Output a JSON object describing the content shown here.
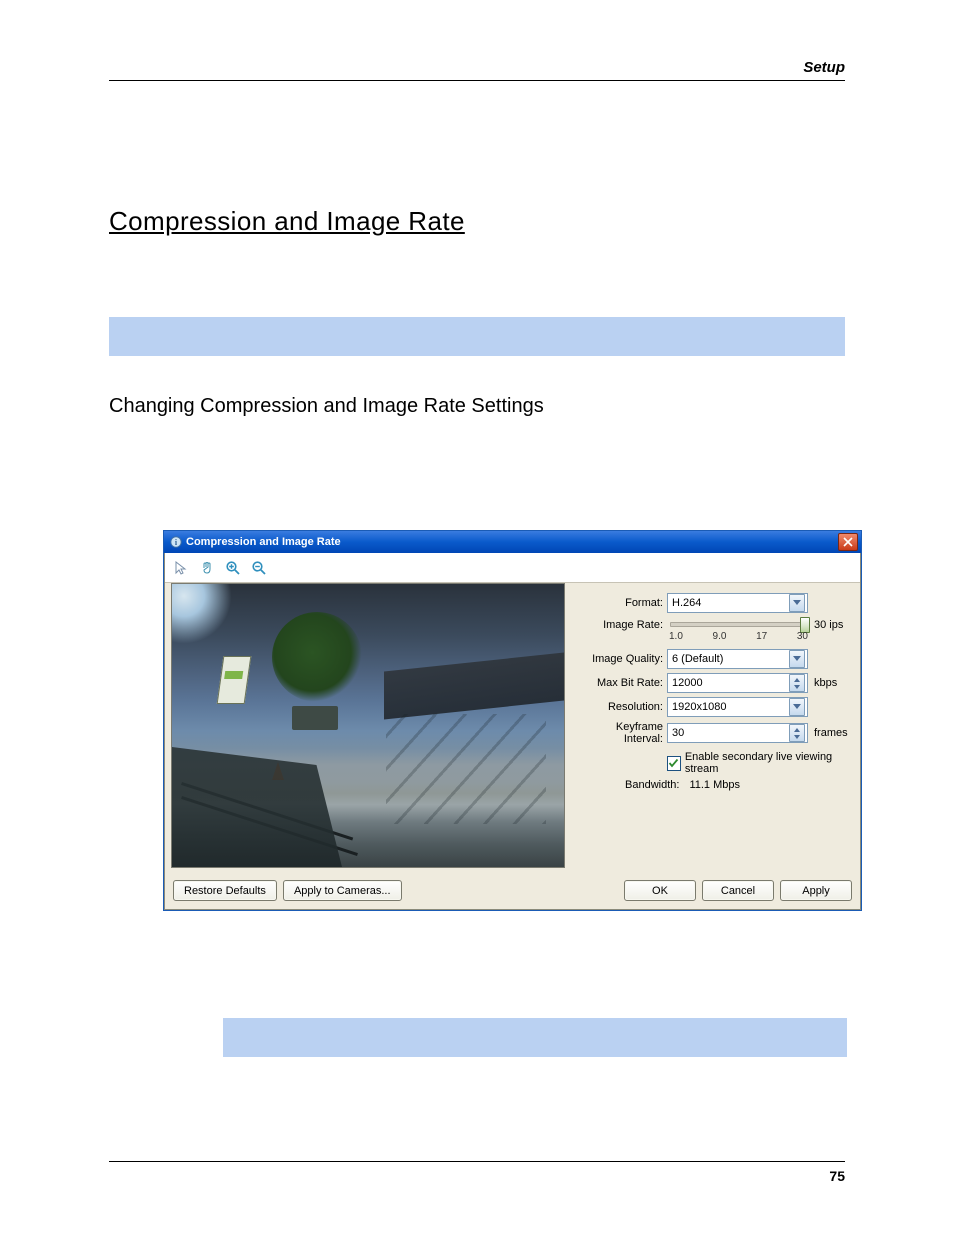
{
  "page": {
    "header": "Setup",
    "number": "75",
    "section_title": "Compression and Image Rate",
    "subheading": "Changing Compression and Image Rate Settings"
  },
  "dialog": {
    "title": "Compression and Image Rate",
    "fields": {
      "format": {
        "label": "Format:",
        "value": "H.264"
      },
      "image_rate": {
        "label": "Image Rate:",
        "ticks": [
          "1.0",
          "9.0",
          "17",
          "30"
        ],
        "value_label": "30 ips",
        "value": 30,
        "min": 1.0,
        "max": 30
      },
      "image_quality": {
        "label": "Image Quality:",
        "value": "6 (Default)"
      },
      "max_bit_rate": {
        "label": "Max Bit Rate:",
        "value": "12000",
        "unit": "kbps"
      },
      "resolution": {
        "label": "Resolution:",
        "value": "1920x1080"
      },
      "keyframe_interval": {
        "label": "Keyframe Interval:",
        "value": "30",
        "unit": "frames"
      },
      "enable_secondary": {
        "label": "Enable secondary live viewing stream",
        "checked": true
      },
      "bandwidth": {
        "label": "Bandwidth:",
        "value": "11.1 Mbps"
      }
    },
    "buttons": {
      "restore_defaults": "Restore Defaults",
      "apply_to_cameras": "Apply to Cameras...",
      "ok": "OK",
      "cancel": "Cancel",
      "apply": "Apply"
    }
  }
}
